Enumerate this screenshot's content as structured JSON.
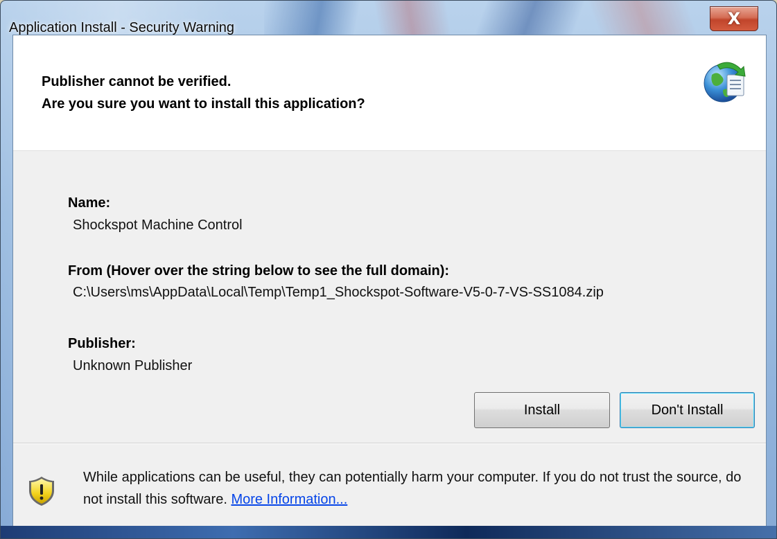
{
  "window": {
    "title": "Application Install - Security Warning",
    "close_glyph": "X"
  },
  "header": {
    "line1": "Publisher cannot be verified.",
    "line2": "Are you sure you want to install this application?",
    "icon": "globe-install-icon"
  },
  "details": {
    "name_label": "Name:",
    "name_value": "Shockspot Machine Control",
    "from_label": "From (Hover over the string below to see the full domain):",
    "from_value": "C:\\Users\\ms\\AppData\\Local\\Temp\\Temp1_Shockspot-Software-V5-0-7-VS-SS1084.zip",
    "publisher_label": "Publisher:",
    "publisher_value": "Unknown Publisher"
  },
  "buttons": {
    "install": "Install",
    "dont_install": "Don't Install"
  },
  "footer": {
    "warning_text": "While applications can be useful, they can potentially harm your computer. If you do not trust the source, do not install this software. ",
    "more_info_link": "More Information...",
    "icon": "warning-shield-icon"
  },
  "colors": {
    "link": "#0645e8",
    "close_button": "#c1452b",
    "client_background": "#f0f0f0"
  }
}
